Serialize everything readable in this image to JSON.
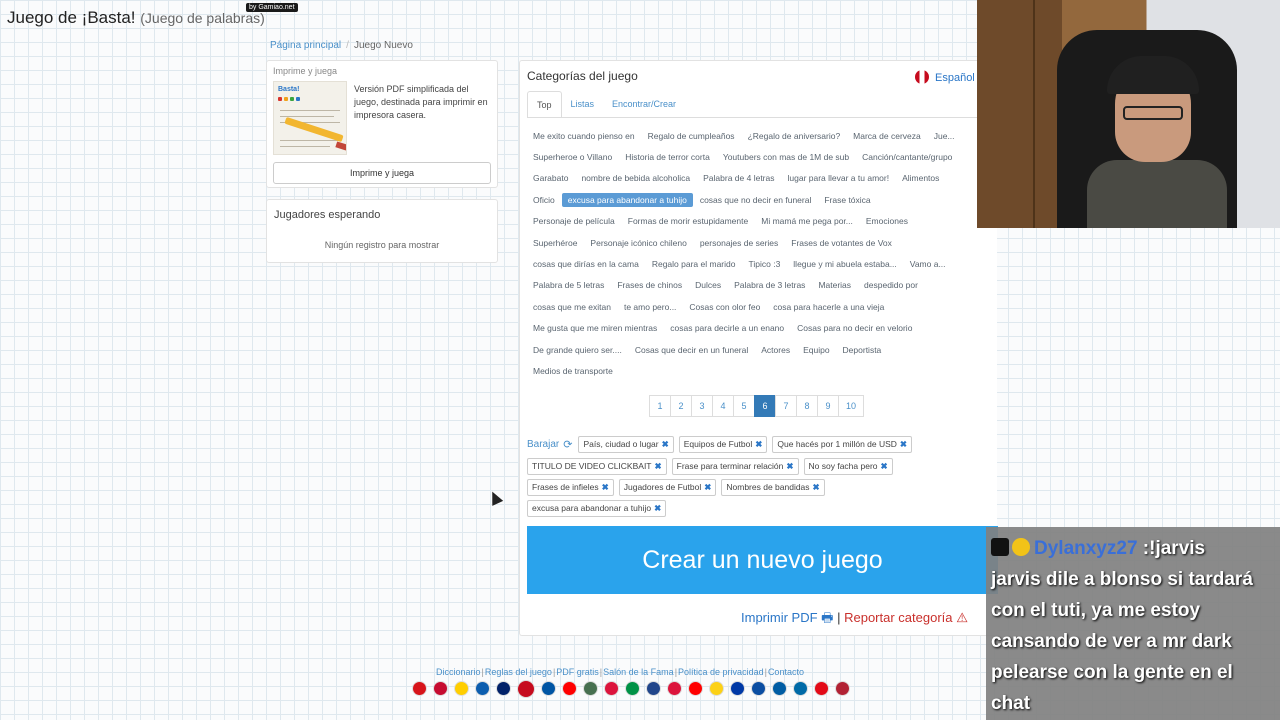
{
  "header": {
    "title": "Juego de ¡Basta!",
    "subtitle": "(Juego de palabras)",
    "badge": "by Gamiao.net"
  },
  "breadcrumb": {
    "home": "Página principal",
    "current": "Juego Nuevo"
  },
  "print_panel": {
    "title": "Imprime y juega",
    "thumb_logo": "Basta!",
    "description": "Versión PDF simplificada del juego, destinada para imprimir en impresora casera.",
    "button": "Imprime y juega"
  },
  "players_panel": {
    "title": "Jugadores esperando",
    "empty": "Ningún registro para mostrar"
  },
  "categories": {
    "title": "Categorías del juego",
    "language": "Español",
    "tabs": [
      "Top",
      "Listas",
      "Encontrar/Crear"
    ],
    "rows": [
      [
        {
          "label": "Me exito cuando pienso en"
        },
        {
          "label": "Regalo de cumpleaños"
        },
        {
          "label": "¿Regalo de aniversario?"
        },
        {
          "label": "Marca de cerveza"
        },
        {
          "label": "Jue..."
        }
      ],
      [
        {
          "label": "Superheroe o Villano"
        },
        {
          "label": "Historia de terror corta"
        },
        {
          "label": "Youtubers con mas de 1M de sub"
        },
        {
          "label": "Canción/cantante/grupo"
        }
      ],
      [
        {
          "label": "Garabato"
        },
        {
          "label": "nombre de bebida alcoholica"
        },
        {
          "label": "Palabra de 4 letras"
        },
        {
          "label": "lugar para llevar a tu amor!"
        },
        {
          "label": "Alimentos"
        }
      ],
      [
        {
          "label": "Oficio"
        },
        {
          "label": "excusa para abandonar a tuhijo",
          "selected": true
        },
        {
          "label": "cosas que no decir en funeral"
        },
        {
          "label": "Frase tóxica"
        }
      ],
      [
        {
          "label": "Personaje de película"
        },
        {
          "label": "Formas de morir estupidamente"
        },
        {
          "label": "Mi mamá me pega por..."
        },
        {
          "label": "Emociones"
        }
      ],
      [
        {
          "label": "Superhéroe"
        },
        {
          "label": "Personaje icónico chileno"
        },
        {
          "label": "personajes de series"
        },
        {
          "label": "Frases de votantes de Vox"
        }
      ],
      [
        {
          "label": "cosas que dirías en la cama"
        },
        {
          "label": "Regalo para el marido"
        },
        {
          "label": "Tipico :3"
        },
        {
          "label": "llegue y mi abuela estaba..."
        },
        {
          "label": "Vamo a..."
        }
      ],
      [
        {
          "label": "Palabra de 5 letras"
        },
        {
          "label": "Frases de chinos"
        },
        {
          "label": "Dulces"
        },
        {
          "label": "Palabra de 3 letras"
        },
        {
          "label": "Materias"
        },
        {
          "label": "despedido por"
        }
      ],
      [
        {
          "label": "cosas que me exitan"
        },
        {
          "label": "te amo pero..."
        },
        {
          "label": "Cosas con olor feo"
        },
        {
          "label": "cosa para hacerle a una vieja"
        }
      ],
      [
        {
          "label": "Me gusta que me miren mientras"
        },
        {
          "label": "cosas para decirle a un enano"
        },
        {
          "label": "Cosas para no decir en velorio"
        }
      ],
      [
        {
          "label": "De grande quiero ser...."
        },
        {
          "label": "Cosas que decir en un funeral"
        },
        {
          "label": "Actores"
        },
        {
          "label": "Equipo"
        },
        {
          "label": "Deportista"
        }
      ],
      [
        {
          "label": "Medios de transporte"
        }
      ]
    ],
    "pages": [
      "1",
      "2",
      "3",
      "4",
      "5",
      "6",
      "7",
      "8",
      "9",
      "10"
    ],
    "active_page": "6"
  },
  "selected": {
    "shuffle": "Barajar",
    "rows": [
      [
        "País, ciudad o lugar",
        "Equipos de Futbol",
        "Que hacés por 1 millón de USD"
      ],
      [
        "TITULO DE VIDEO CLICKBAIT",
        "Frase para terminar relación",
        "No soy facha pero"
      ],
      [
        "Frases de infieles",
        "Jugadores de Futbol",
        "Nombres de bandidas"
      ],
      [
        "excusa para abandonar a tuhijo"
      ]
    ]
  },
  "actions": {
    "create": "Crear un nuevo juego",
    "print_pdf": "Imprimir PDF",
    "separator": "|",
    "report": "Reportar categoría"
  },
  "footer": {
    "links": [
      "Diccionario",
      "Reglas del juego",
      "PDF gratis",
      "Salón de la Fama",
      "Política de privacidad",
      "Contacto"
    ],
    "flag_colors": [
      "#d7141a",
      "#c60c30",
      "#ffce00",
      "#0d5eaf",
      "#012169",
      "#c60b1e",
      "#0055a4",
      "#ff0000",
      "#477050",
      "#dc143c",
      "#009246",
      "#21468b",
      "#dc143c",
      "#ff0000",
      "#fcd116",
      "#0039a6",
      "#0b4ea2",
      "#005da4",
      "#006aa7",
      "#e30a17",
      "#b22234"
    ],
    "current_flag": 5
  },
  "chat": {
    "user": "Dylanxyz27",
    "messages": [
      ":!jarvis",
      "jarvis dile a blonso si tardará",
      "con el tuti, ya me estoy",
      "cansando de ver a mr dark",
      "pelearse con la gente en el",
      "chat"
    ]
  }
}
